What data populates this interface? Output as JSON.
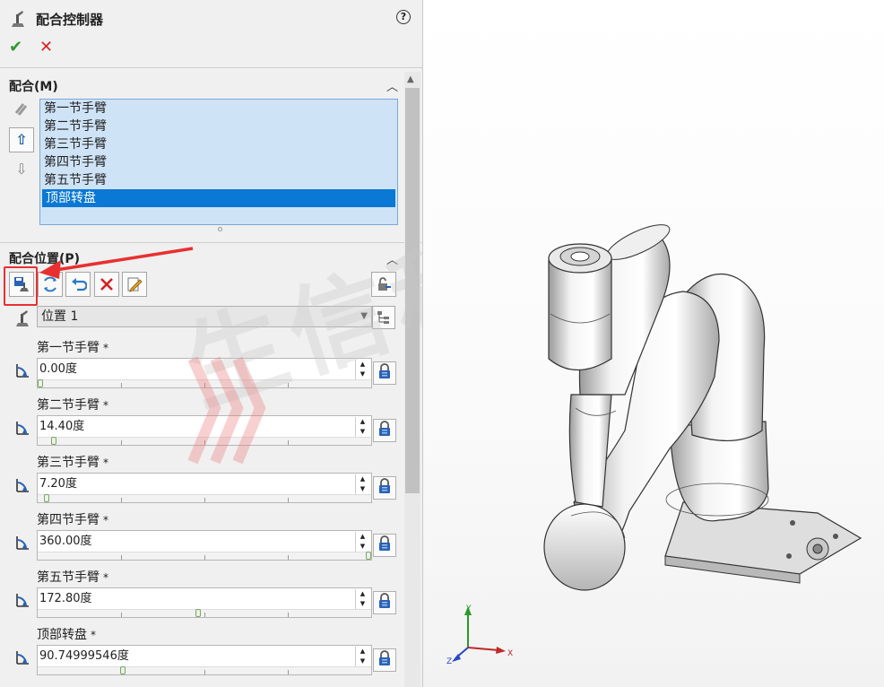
{
  "header": {
    "title": "配合控制器",
    "help": "?"
  },
  "actions": {
    "ok": "✔",
    "cancel": "✕"
  },
  "mates": {
    "title": "配合(M)",
    "items": [
      "第一节手臂",
      "第二节手臂",
      "第三节手臂",
      "第四节手臂",
      "第五节手臂",
      "顶部转盘"
    ],
    "selected_index": 5
  },
  "positions": {
    "title": "配合位置(P)",
    "combo_value": "位置 1"
  },
  "rows": [
    {
      "label": "第一节手臂",
      "value": "0.00度",
      "slider": 0.0
    },
    {
      "label": "第二节手臂",
      "value": "14.40度",
      "slider": 0.04
    },
    {
      "label": "第三节手臂",
      "value": "7.20度",
      "slider": 0.02
    },
    {
      "label": "第四节手臂",
      "value": "360.00度",
      "slider": 1.0
    },
    {
      "label": "第五节手臂",
      "value": "172.80度",
      "slider": 0.48
    },
    {
      "label": "顶部转盘",
      "value": "90.74999546度",
      "slider": 0.25
    }
  ],
  "required_mark": "*",
  "watermark": "生信科",
  "triad": {
    "x": "X",
    "y": "Y",
    "z": "Z"
  },
  "colors": {
    "selection": "#0a78d4",
    "list_bg": "#cfe3f7",
    "highlight": "#e83030"
  }
}
